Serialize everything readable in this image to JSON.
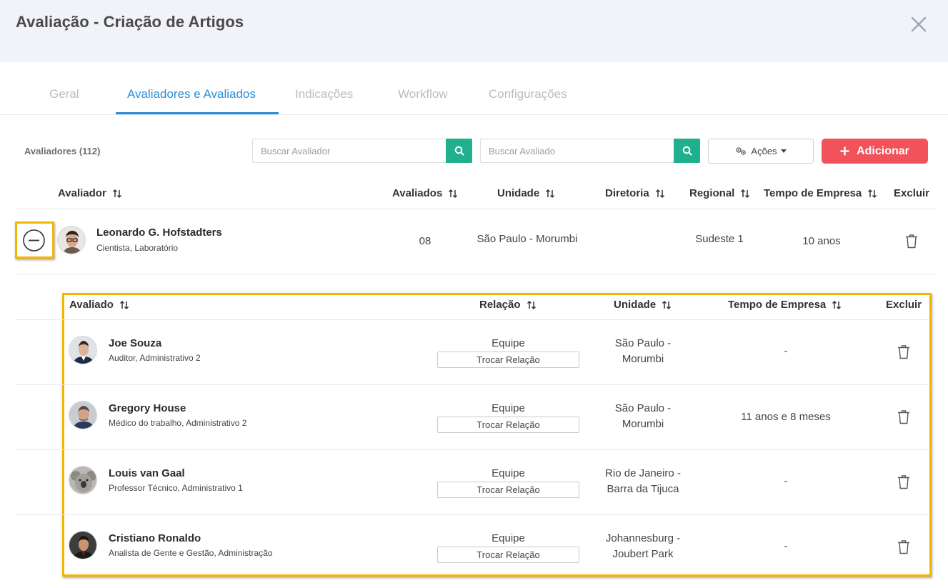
{
  "modal": {
    "title": "Avaliação - Criação de Artigos"
  },
  "tabs": [
    {
      "label": "Geral"
    },
    {
      "label": "Avaliadores e Avaliados"
    },
    {
      "label": "Indicações"
    },
    {
      "label": "Workflow"
    },
    {
      "label": "Configurações"
    }
  ],
  "toolbar": {
    "count_label": "Avaliadores (112)",
    "search_evaluator_placeholder": "Buscar Avaliador",
    "search_evaluated_placeholder": "Buscar Avaliado",
    "actions_label": "Ações",
    "add_label": "Adicionar",
    "add_color": "#f2525a",
    "search_color": "#21b08e"
  },
  "evaluators_table": {
    "headers": {
      "evaluator": "Avaliador",
      "evaluated": "Avaliados",
      "unit": "Unidade",
      "board": "Diretoria",
      "region": "Regional",
      "tenure": "Tempo de Empresa",
      "delete": "Excluir"
    },
    "rows": [
      {
        "name": "Leonardo G. Hofstadters",
        "role": "Cientista, Laboratório",
        "evaluated_count": "08",
        "unit": "São Paulo - Morumbi",
        "board": "",
        "region": "Sudeste 1",
        "tenure": "10 anos",
        "avatar_icon": "avatar-leonardo-icon"
      }
    ]
  },
  "evaluated_table": {
    "headers": {
      "evaluated": "Avaliado",
      "relation": "Relação",
      "unit": "Unidade",
      "tenure": "Tempo de Empresa",
      "delete": "Excluir"
    },
    "rows": [
      {
        "name": "Joe Souza",
        "role": "Auditor, Administrativo 2",
        "relation": "Equipe",
        "swap_label": "Trocar Relação",
        "unit_line1": "São Paulo -",
        "unit_line2": "Morumbi",
        "tenure": "-"
      },
      {
        "name": "Gregory House",
        "role": "Médico do trabalho, Administrativo 2",
        "relation": "Equipe",
        "swap_label": "Trocar Relação",
        "unit_line1": "São Paulo -",
        "unit_line2": "Morumbi",
        "tenure": "11 anos e 8 meses"
      },
      {
        "name": "Louis van Gaal",
        "role": "Professor Técnico, Administrativo 1",
        "relation": "Equipe",
        "swap_label": "Trocar Relação",
        "unit_line1": "Rio de Janeiro -",
        "unit_line2": "Barra da Tijuca",
        "tenure": "-"
      },
      {
        "name": "Cristiano Ronaldo",
        "role": "Analista de Gente e Gestão, Administração",
        "relation": "Equipe",
        "swap_label": "Trocar Relação",
        "unit_line1": "Johannesburg -",
        "unit_line2": "Joubert Park",
        "tenure": "-"
      }
    ]
  },
  "colors": {
    "accent": "#2d8ed6",
    "highlight": "#f2b600",
    "header_bg": "#f1f3f8"
  }
}
